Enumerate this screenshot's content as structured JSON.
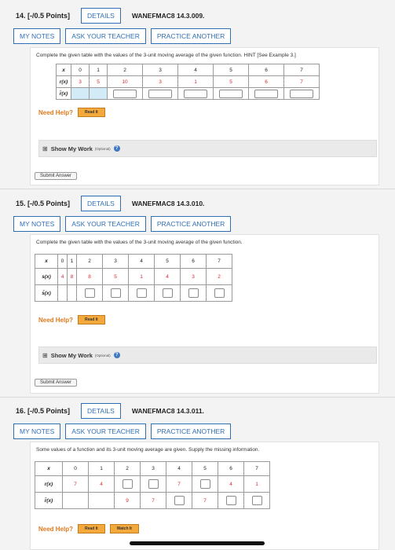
{
  "q14": {
    "number": "14. [-/0.5 Points]",
    "details": "DETAILS",
    "code": "WANEFMAC8 14.3.009.",
    "my_notes": "MY NOTES",
    "ask_teacher": "ASK YOUR TEACHER",
    "practice": "PRACTICE ANOTHER",
    "instructions": "Complete the given table with the values of the 3-unit moving average of the given function. HINT [See Example 3.]",
    "x_label": "x",
    "x_values": [
      "0",
      "1",
      "2",
      "3",
      "4",
      "5",
      "6",
      "7"
    ],
    "f_label": "r(x)",
    "f_values": [
      "3",
      "5",
      "10",
      "3",
      "1",
      "5",
      "6",
      "7"
    ],
    "avg_label": "r̄(x)",
    "need_help": "Need Help?",
    "read_it": "Read It",
    "show_work": "Show My Work",
    "optional": "(Optional)",
    "submit": "Submit Answer"
  },
  "q15": {
    "number": "15. [-/0.5 Points]",
    "details": "DETAILS",
    "code": "WANEFMAC8 14.3.010.",
    "my_notes": "MY NOTES",
    "ask_teacher": "ASK YOUR TEACHER",
    "practice": "PRACTICE ANOTHER",
    "instructions": "Complete the given table with the values of the 3-unit moving average of the given function.",
    "x_label": "x",
    "x_values": [
      "0",
      "1",
      "2",
      "3",
      "4",
      "5",
      "6",
      "7"
    ],
    "f_label": "s(x)",
    "f_values": [
      "4",
      "8",
      "8",
      "5",
      "1",
      "4",
      "3",
      "2"
    ],
    "avg_label": "s̄(x)",
    "need_help": "Need Help?",
    "read_it": "Read It",
    "show_work": "Show My Work",
    "optional": "(Optional)",
    "submit": "Submit Answer"
  },
  "q16": {
    "number": "16. [-/0.5 Points]",
    "details": "DETAILS",
    "code": "WANEFMAC8 14.3.011.",
    "my_notes": "MY NOTES",
    "ask_teacher": "ASK YOUR TEACHER",
    "practice": "PRACTICE ANOTHER",
    "instructions": "Some values of a function and its 3-unit moving average are given. Supply the missing information.",
    "x_label": "x",
    "x_values": [
      "0",
      "1",
      "2",
      "3",
      "4",
      "5",
      "6",
      "7"
    ],
    "f_label": "r(x)",
    "f_values": [
      "7",
      "4",
      "",
      "",
      "7",
      "",
      "4",
      "1"
    ],
    "avg_label": "r̄(x)",
    "avg_values": [
      "",
      "",
      "9",
      "7",
      "",
      "7",
      "",
      ""
    ],
    "need_help": "Need Help?",
    "read_it": "Read It",
    "watch_it": "Watch It"
  },
  "colors": {
    "accent": "#2f6fb3",
    "red_values": "#d9272e",
    "help_orange": "#e07b1e"
  }
}
